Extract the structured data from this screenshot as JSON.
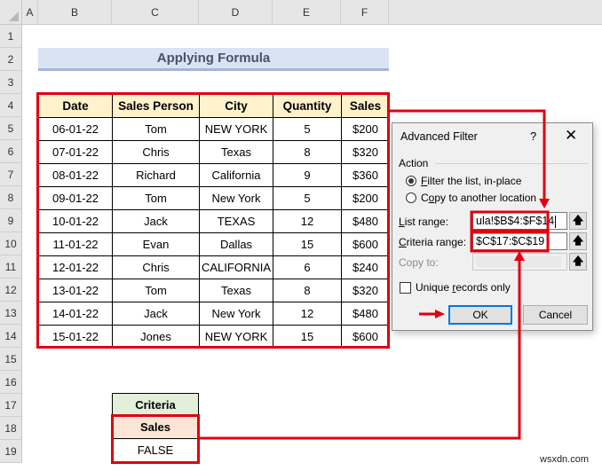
{
  "spreadsheet": {
    "columns": [
      "A",
      "B",
      "C",
      "D",
      "E",
      "F"
    ],
    "rows": [
      "1",
      "2",
      "3",
      "4",
      "5",
      "6",
      "7",
      "8",
      "9",
      "10",
      "11",
      "12",
      "13",
      "14",
      "15",
      "16",
      "17",
      "18",
      "19"
    ],
    "title": "Applying Formula",
    "table": {
      "headers": [
        "Date",
        "Sales Person",
        "City",
        "Quantity",
        "Sales"
      ],
      "rows": [
        [
          "06-01-22",
          "Tom",
          "NEW YORK",
          "5",
          "$200"
        ],
        [
          "07-01-22",
          "Chris",
          "Texas",
          "8",
          "$320"
        ],
        [
          "08-01-22",
          "Richard",
          "California",
          "9",
          "$360"
        ],
        [
          "09-01-22",
          "Tom",
          "New York",
          "5",
          "$200"
        ],
        [
          "10-01-22",
          "Jack",
          "TEXAS",
          "12",
          "$480"
        ],
        [
          "11-01-22",
          "Evan",
          "Dallas",
          "15",
          "$600"
        ],
        [
          "12-01-22",
          "Chris",
          "CALIFORNIA",
          "6",
          "$240"
        ],
        [
          "13-01-22",
          "Tom",
          "Texas",
          "8",
          "$320"
        ],
        [
          "14-01-22",
          "Jack",
          "New York",
          "12",
          "$480"
        ],
        [
          "15-01-22",
          "Jones",
          "NEW YORK",
          "15",
          "$600"
        ]
      ]
    },
    "criteria": {
      "title": "Criteria",
      "header": "Sales",
      "value": "FALSE"
    }
  },
  "dialog": {
    "title": "Advanced Filter",
    "help_label": "?",
    "close_label": "✕",
    "action_label": "Action",
    "options": [
      {
        "prefix": "",
        "ul": "F",
        "rest": "ilter the list, in-place",
        "selected": true
      },
      {
        "prefix": "C",
        "ul": "o",
        "rest": "py to another location",
        "selected": false
      }
    ],
    "list_range": {
      "label_ul": "L",
      "label_rest": "ist range:",
      "value": "ula!$B$4:$F$14"
    },
    "criteria_range": {
      "label_ul": "C",
      "label_rest": "riteria range:",
      "value": "$C$17:$C$19"
    },
    "copy_to": {
      "label": "Copy to:",
      "value": ""
    },
    "picker_icon": "🡅",
    "unique": {
      "prefix": "Unique ",
      "ul": "r",
      "rest": "ecords only",
      "checked": false
    },
    "ok_label": "OK",
    "cancel_label": "Cancel"
  },
  "annotation_color": "#e0000f",
  "watermark": "wsxdn.com"
}
